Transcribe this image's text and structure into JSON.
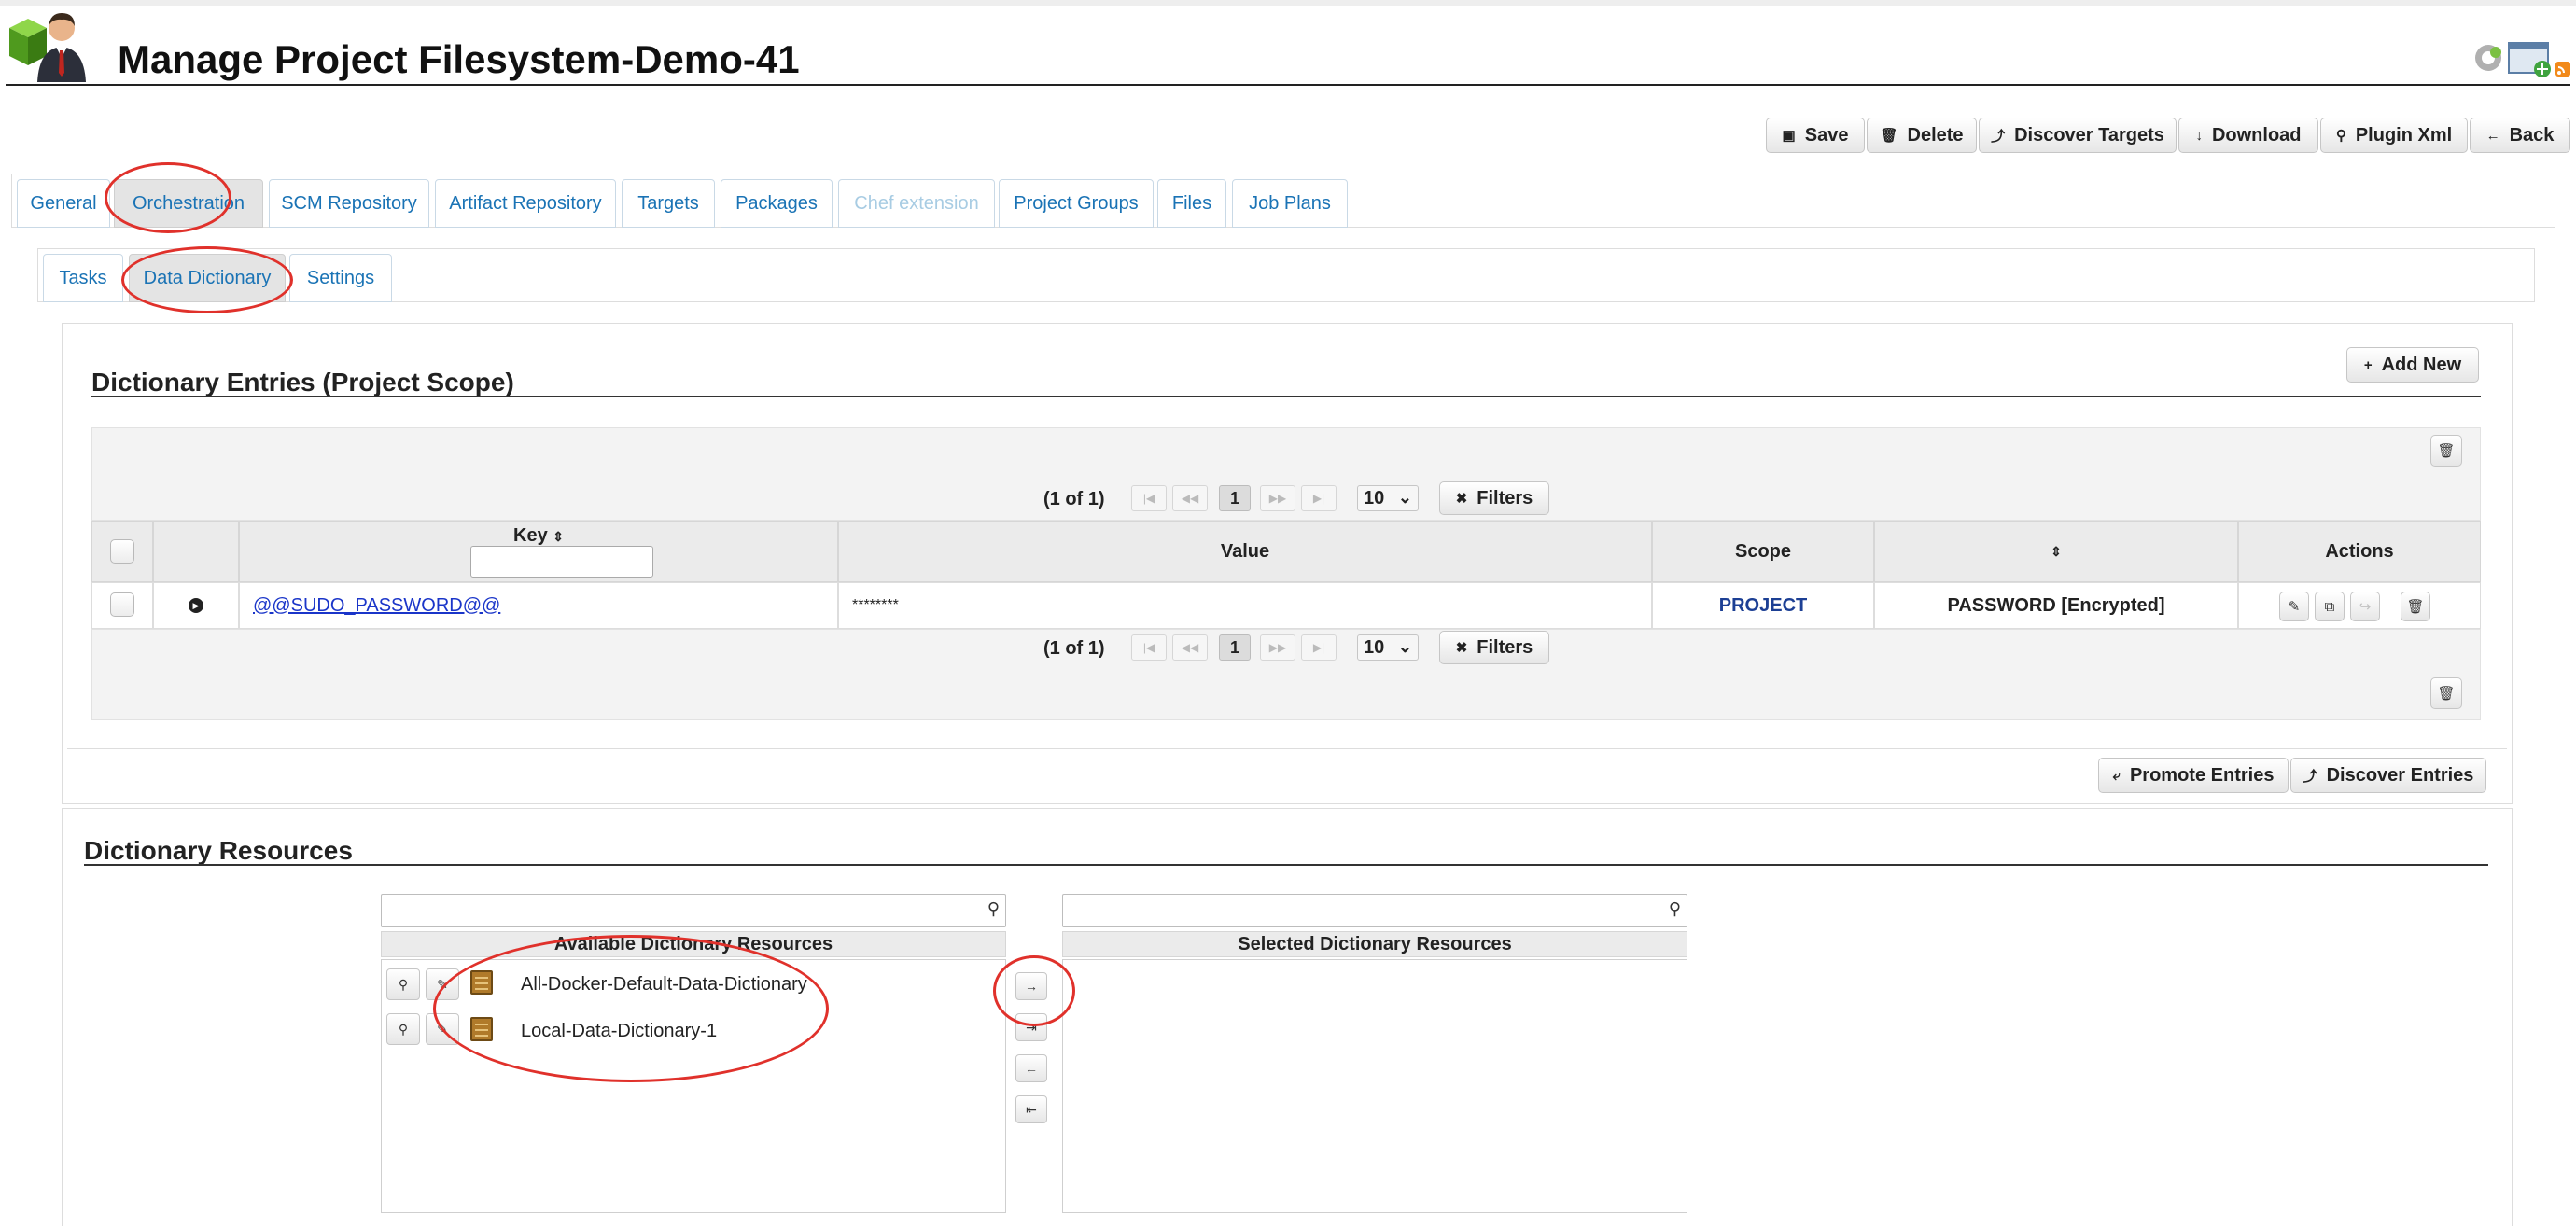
{
  "page": {
    "title": "Manage Project Filesystem-Demo-41",
    "logo_icon": "user-avatar-with-cube-icon",
    "corner_icons": [
      "gear-icon",
      "add-window-icon",
      "rss-icon"
    ]
  },
  "toolbar": {
    "buttons": [
      {
        "label": "Save",
        "icon": "save-icon"
      },
      {
        "label": "Delete",
        "icon": "trash-icon"
      },
      {
        "label": "Discover Targets",
        "icon": "discover-icon"
      },
      {
        "label": "Download",
        "icon": "download-icon"
      },
      {
        "label": "Plugin Xml",
        "icon": "search-icon"
      },
      {
        "label": "Back",
        "icon": "arrow-left-icon"
      }
    ]
  },
  "main_tabs": [
    {
      "label": "General"
    },
    {
      "label": "Orchestration",
      "active": true
    },
    {
      "label": "SCM Repository"
    },
    {
      "label": "Artifact Repository"
    },
    {
      "label": "Targets"
    },
    {
      "label": "Packages"
    },
    {
      "label": "Chef extension",
      "disabled": true
    },
    {
      "label": "Project Groups"
    },
    {
      "label": "Files"
    },
    {
      "label": "Job Plans"
    }
  ],
  "sub_tabs": [
    {
      "label": "Tasks"
    },
    {
      "label": "Data Dictionary",
      "active": true
    },
    {
      "label": "Settings"
    }
  ],
  "entries": {
    "title": "Dictionary Entries (Project Scope)",
    "add_new_label": "Add New",
    "pager": {
      "text": "(1 of 1)",
      "current_page": "1",
      "rows_per_page": "10",
      "filters_label": "Filters"
    },
    "columns": {
      "key": "Key",
      "value": "Value",
      "scope": "Scope",
      "type": "",
      "actions": "Actions"
    },
    "rows": [
      {
        "key": "@@SUDO_PASSWORD@@",
        "value": "********",
        "scope": "PROJECT",
        "type": "PASSWORD [Encrypted]"
      }
    ],
    "footer_buttons": {
      "promote": "Promote Entries",
      "discover": "Discover Entries"
    }
  },
  "resources": {
    "title": "Dictionary Resources",
    "available_header": "Available Dictionary Resources",
    "selected_header": "Selected Dictionary Resources",
    "available_items": [
      {
        "label": "All-Docker-Default-Data-Dictionary"
      },
      {
        "label": "Local-Data-Dictionary-1"
      }
    ],
    "selected_items": []
  },
  "colors": {
    "link": "#1a73b5",
    "scope_text": "#1c3f94",
    "annotation": "#e0312b"
  }
}
